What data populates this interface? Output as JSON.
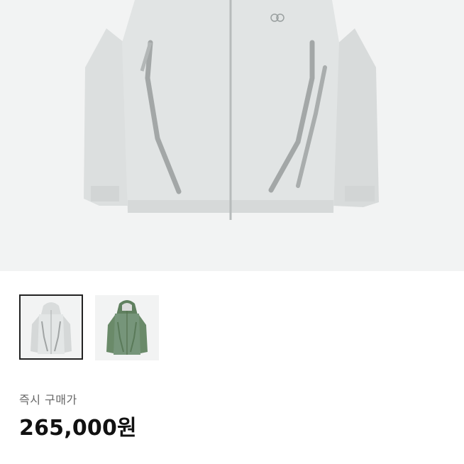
{
  "product": {
    "images": [
      {
        "name": "jacket-light-grey",
        "color": "#dfe2e2",
        "selected": true
      },
      {
        "name": "jacket-green",
        "color": "#6f8f6e",
        "selected": false
      }
    ],
    "price_label": "즉시 구매가",
    "price_value": "265,000원"
  },
  "colors": {
    "hero_background": "#f2f3f3",
    "selected_border": "#222222"
  }
}
